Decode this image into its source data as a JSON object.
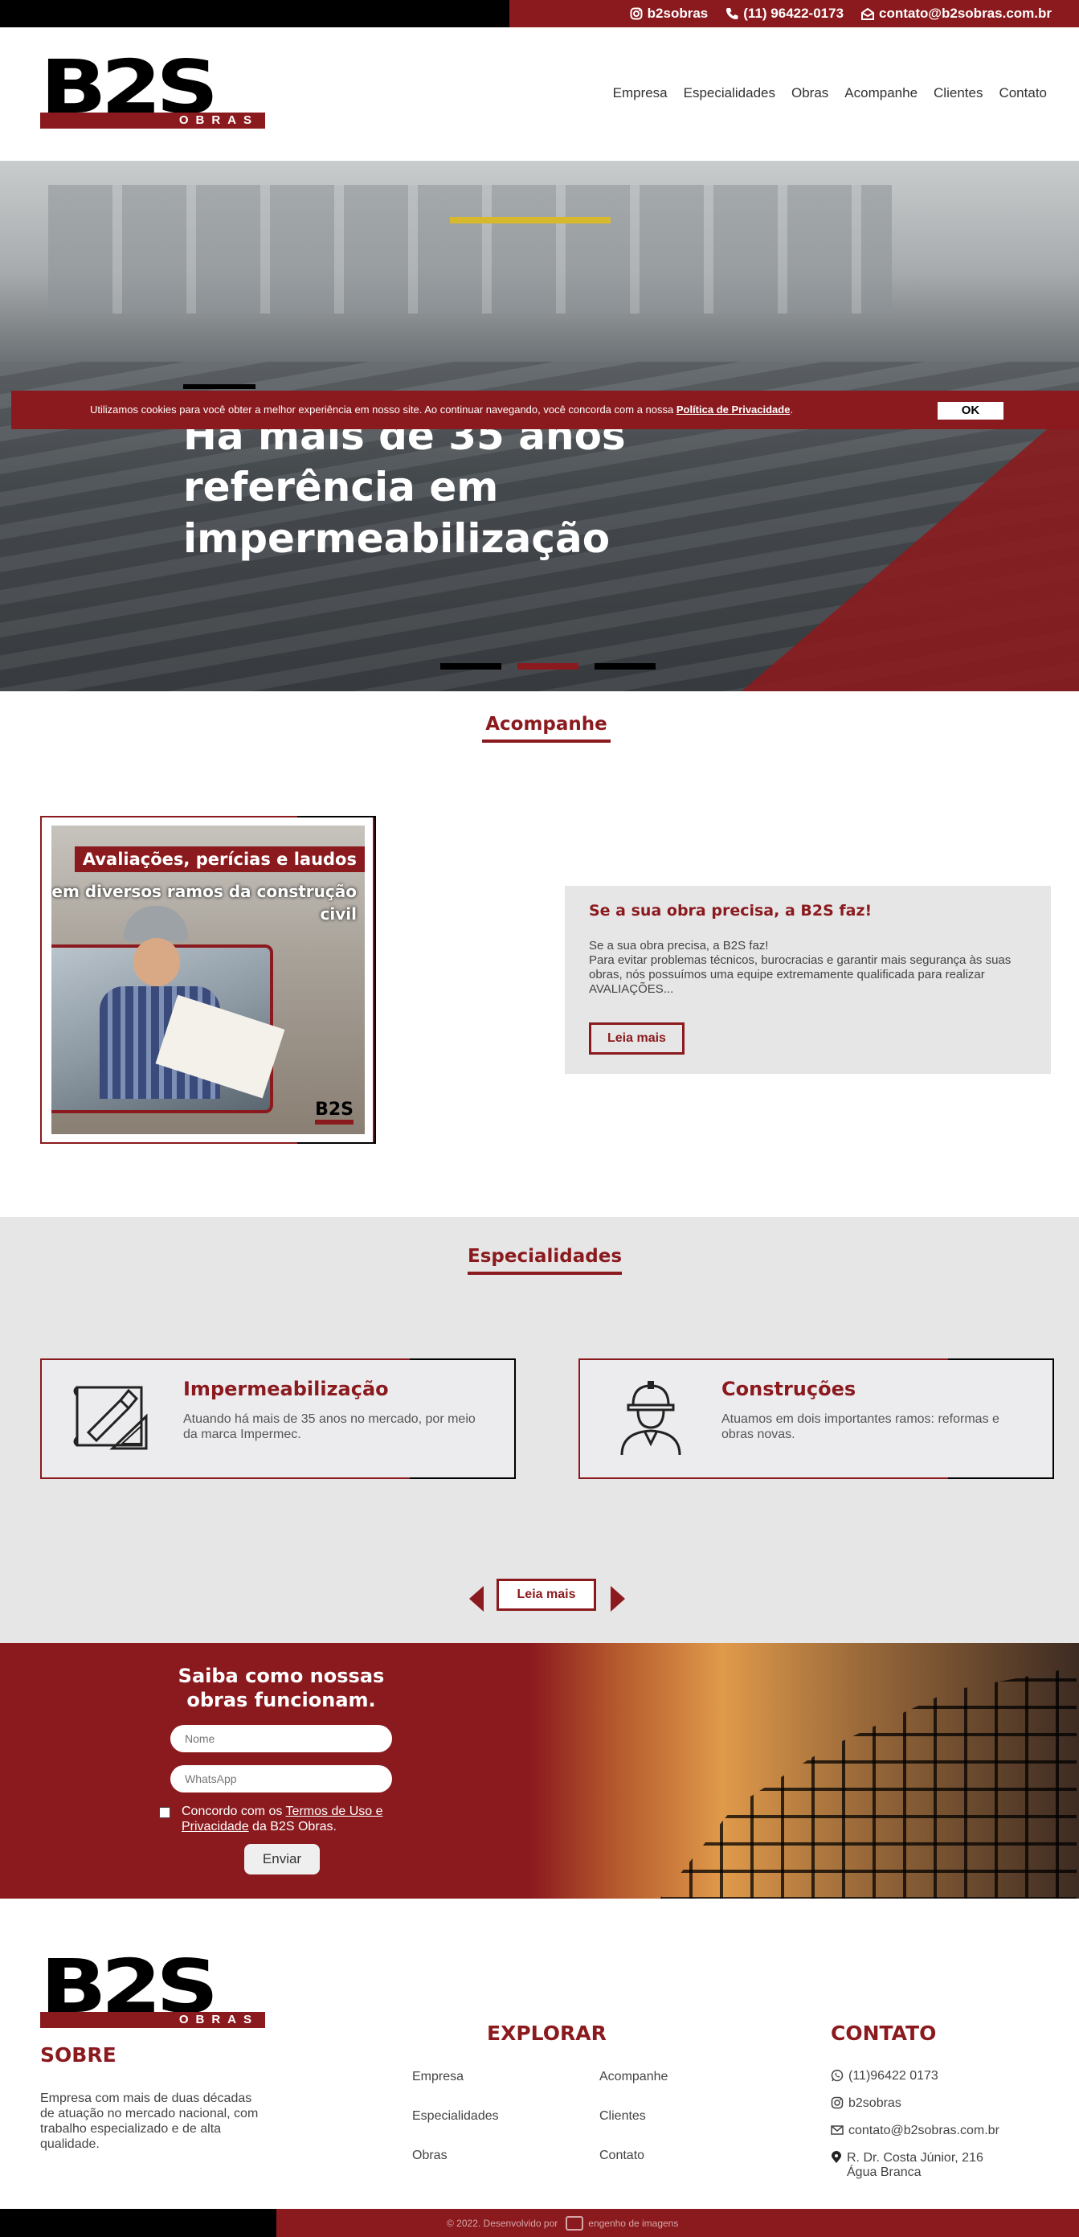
{
  "topbar": {
    "instagram": "b2sobras",
    "phone": "(11) 96422-0173",
    "email": "contato@b2sobras.com.br"
  },
  "logo": {
    "main": "B2S",
    "sub": "OBRAS"
  },
  "nav": [
    "Empresa",
    "Especialidades",
    "Obras",
    "Acompanhe",
    "Clientes",
    "Contato"
  ],
  "hero": {
    "headline": "Há mais de 35 anos referência em impermeabilização",
    "slides": 3,
    "active_slide": 2
  },
  "cookie": {
    "text": "Utilizamos cookies para você obter a melhor experiência em nosso site. Ao continuar navegando, você concorda com a nossa ",
    "link": "Política de Privacidade",
    "end": ".",
    "ok": "OK"
  },
  "acompanhe": {
    "title": "Acompanhe",
    "image_banner1": "Avaliações, perícias e laudos",
    "image_banner2": "em diversos ramos da construção civil",
    "image_logo": "B2S",
    "post_title": "Se a sua obra precisa, a B2S faz!",
    "post_text": "Se a sua obra precisa, a B2S faz!\nPara evitar problemas técnicos, burocracias e garantir mais segurança às suas obras, nós possuímos uma equipe extremamente qualificada para realizar AVALIAÇÕES...",
    "read_more": "Leia mais"
  },
  "especialidades": {
    "title": "Especialidades",
    "cards": [
      {
        "title": "Impermeabilização",
        "text": "Atuando há mais de 35 anos no mercado, por meio da marca Impermec.",
        "icon": "blueprint-icon"
      },
      {
        "title": "Construções",
        "text": "Atuamos em dois importantes ramos: reformas e obras novas.",
        "icon": "worker-icon"
      }
    ],
    "read_more": "Leia mais"
  },
  "cta": {
    "title": "Saiba como nossas obras funcionam.",
    "name_placeholder": "Nome",
    "whatsapp_placeholder": "WhatsApp",
    "agree_pre": "Concordo com os ",
    "agree_link": "Termos de Uso e Privacidade",
    "agree_post": " da B2S Obras.",
    "submit": "Enviar"
  },
  "footer": {
    "sobre_title": "SOBRE",
    "sobre_text": "Empresa com mais de duas décadas de atuação no mercado nacional, com trabalho especializado e de alta qualidade.",
    "explorar_title": "EXPLORAR",
    "links_col1": [
      "Empresa",
      "Especialidades",
      "Obras"
    ],
    "links_col2": [
      "Acompanhe",
      "Clientes",
      "Contato"
    ],
    "contato_title": "CONTATO",
    "whatsapp": "(11)96422 0173",
    "instagram": "b2sobras",
    "email": "contato@b2sobras.com.br",
    "address_line1": "R. Dr. Costa Júnior, 216",
    "address_line2": "Água Branca"
  },
  "bottom": {
    "credit": "© 2022. Desenvolvido por",
    "company": "engenho de imagens"
  },
  "colors": {
    "brand_red": "#8b1a1e",
    "black": "#000000",
    "light_gray": "#e6e6e6"
  }
}
